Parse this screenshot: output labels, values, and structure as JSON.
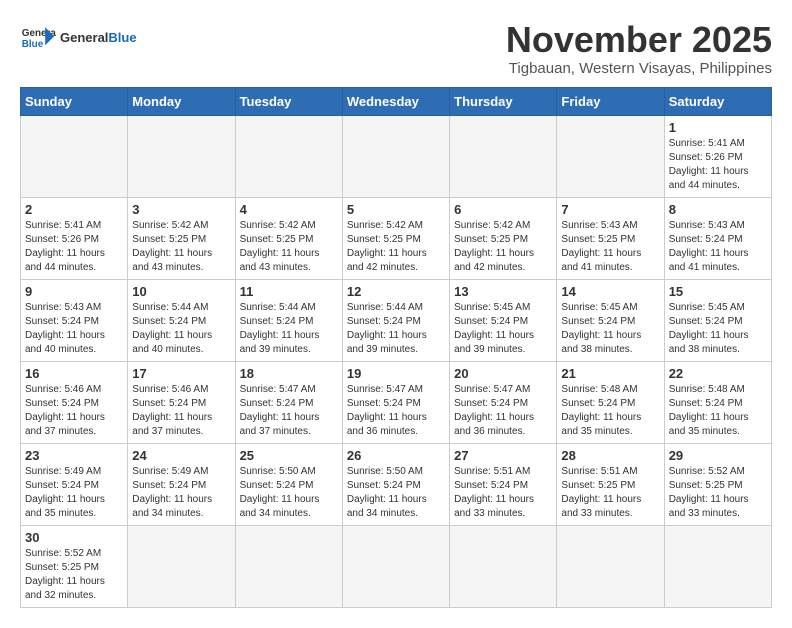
{
  "header": {
    "logo_general": "General",
    "logo_blue": "Blue",
    "month_title": "November 2025",
    "location": "Tigbauan, Western Visayas, Philippines"
  },
  "weekdays": [
    "Sunday",
    "Monday",
    "Tuesday",
    "Wednesday",
    "Thursday",
    "Friday",
    "Saturday"
  ],
  "weeks": [
    [
      {
        "day": "",
        "info": ""
      },
      {
        "day": "",
        "info": ""
      },
      {
        "day": "",
        "info": ""
      },
      {
        "day": "",
        "info": ""
      },
      {
        "day": "",
        "info": ""
      },
      {
        "day": "",
        "info": ""
      },
      {
        "day": "1",
        "info": "Sunrise: 5:41 AM\nSunset: 5:26 PM\nDaylight: 11 hours\nand 44 minutes."
      }
    ],
    [
      {
        "day": "2",
        "info": "Sunrise: 5:41 AM\nSunset: 5:26 PM\nDaylight: 11 hours\nand 44 minutes."
      },
      {
        "day": "3",
        "info": "Sunrise: 5:42 AM\nSunset: 5:25 PM\nDaylight: 11 hours\nand 43 minutes."
      },
      {
        "day": "4",
        "info": "Sunrise: 5:42 AM\nSunset: 5:25 PM\nDaylight: 11 hours\nand 43 minutes."
      },
      {
        "day": "5",
        "info": "Sunrise: 5:42 AM\nSunset: 5:25 PM\nDaylight: 11 hours\nand 42 minutes."
      },
      {
        "day": "6",
        "info": "Sunrise: 5:42 AM\nSunset: 5:25 PM\nDaylight: 11 hours\nand 42 minutes."
      },
      {
        "day": "7",
        "info": "Sunrise: 5:43 AM\nSunset: 5:25 PM\nDaylight: 11 hours\nand 41 minutes."
      },
      {
        "day": "8",
        "info": "Sunrise: 5:43 AM\nSunset: 5:24 PM\nDaylight: 11 hours\nand 41 minutes."
      }
    ],
    [
      {
        "day": "9",
        "info": "Sunrise: 5:43 AM\nSunset: 5:24 PM\nDaylight: 11 hours\nand 40 minutes."
      },
      {
        "day": "10",
        "info": "Sunrise: 5:44 AM\nSunset: 5:24 PM\nDaylight: 11 hours\nand 40 minutes."
      },
      {
        "day": "11",
        "info": "Sunrise: 5:44 AM\nSunset: 5:24 PM\nDaylight: 11 hours\nand 39 minutes."
      },
      {
        "day": "12",
        "info": "Sunrise: 5:44 AM\nSunset: 5:24 PM\nDaylight: 11 hours\nand 39 minutes."
      },
      {
        "day": "13",
        "info": "Sunrise: 5:45 AM\nSunset: 5:24 PM\nDaylight: 11 hours\nand 39 minutes."
      },
      {
        "day": "14",
        "info": "Sunrise: 5:45 AM\nSunset: 5:24 PM\nDaylight: 11 hours\nand 38 minutes."
      },
      {
        "day": "15",
        "info": "Sunrise: 5:45 AM\nSunset: 5:24 PM\nDaylight: 11 hours\nand 38 minutes."
      }
    ],
    [
      {
        "day": "16",
        "info": "Sunrise: 5:46 AM\nSunset: 5:24 PM\nDaylight: 11 hours\nand 37 minutes."
      },
      {
        "day": "17",
        "info": "Sunrise: 5:46 AM\nSunset: 5:24 PM\nDaylight: 11 hours\nand 37 minutes."
      },
      {
        "day": "18",
        "info": "Sunrise: 5:47 AM\nSunset: 5:24 PM\nDaylight: 11 hours\nand 37 minutes."
      },
      {
        "day": "19",
        "info": "Sunrise: 5:47 AM\nSunset: 5:24 PM\nDaylight: 11 hours\nand 36 minutes."
      },
      {
        "day": "20",
        "info": "Sunrise: 5:47 AM\nSunset: 5:24 PM\nDaylight: 11 hours\nand 36 minutes."
      },
      {
        "day": "21",
        "info": "Sunrise: 5:48 AM\nSunset: 5:24 PM\nDaylight: 11 hours\nand 35 minutes."
      },
      {
        "day": "22",
        "info": "Sunrise: 5:48 AM\nSunset: 5:24 PM\nDaylight: 11 hours\nand 35 minutes."
      }
    ],
    [
      {
        "day": "23",
        "info": "Sunrise: 5:49 AM\nSunset: 5:24 PM\nDaylight: 11 hours\nand 35 minutes."
      },
      {
        "day": "24",
        "info": "Sunrise: 5:49 AM\nSunset: 5:24 PM\nDaylight: 11 hours\nand 34 minutes."
      },
      {
        "day": "25",
        "info": "Sunrise: 5:50 AM\nSunset: 5:24 PM\nDaylight: 11 hours\nand 34 minutes."
      },
      {
        "day": "26",
        "info": "Sunrise: 5:50 AM\nSunset: 5:24 PM\nDaylight: 11 hours\nand 34 minutes."
      },
      {
        "day": "27",
        "info": "Sunrise: 5:51 AM\nSunset: 5:24 PM\nDaylight: 11 hours\nand 33 minutes."
      },
      {
        "day": "28",
        "info": "Sunrise: 5:51 AM\nSunset: 5:25 PM\nDaylight: 11 hours\nand 33 minutes."
      },
      {
        "day": "29",
        "info": "Sunrise: 5:52 AM\nSunset: 5:25 PM\nDaylight: 11 hours\nand 33 minutes."
      }
    ],
    [
      {
        "day": "30",
        "info": "Sunrise: 5:52 AM\nSunset: 5:25 PM\nDaylight: 11 hours\nand 32 minutes."
      },
      {
        "day": "",
        "info": ""
      },
      {
        "day": "",
        "info": ""
      },
      {
        "day": "",
        "info": ""
      },
      {
        "day": "",
        "info": ""
      },
      {
        "day": "",
        "info": ""
      },
      {
        "day": "",
        "info": ""
      }
    ]
  ]
}
